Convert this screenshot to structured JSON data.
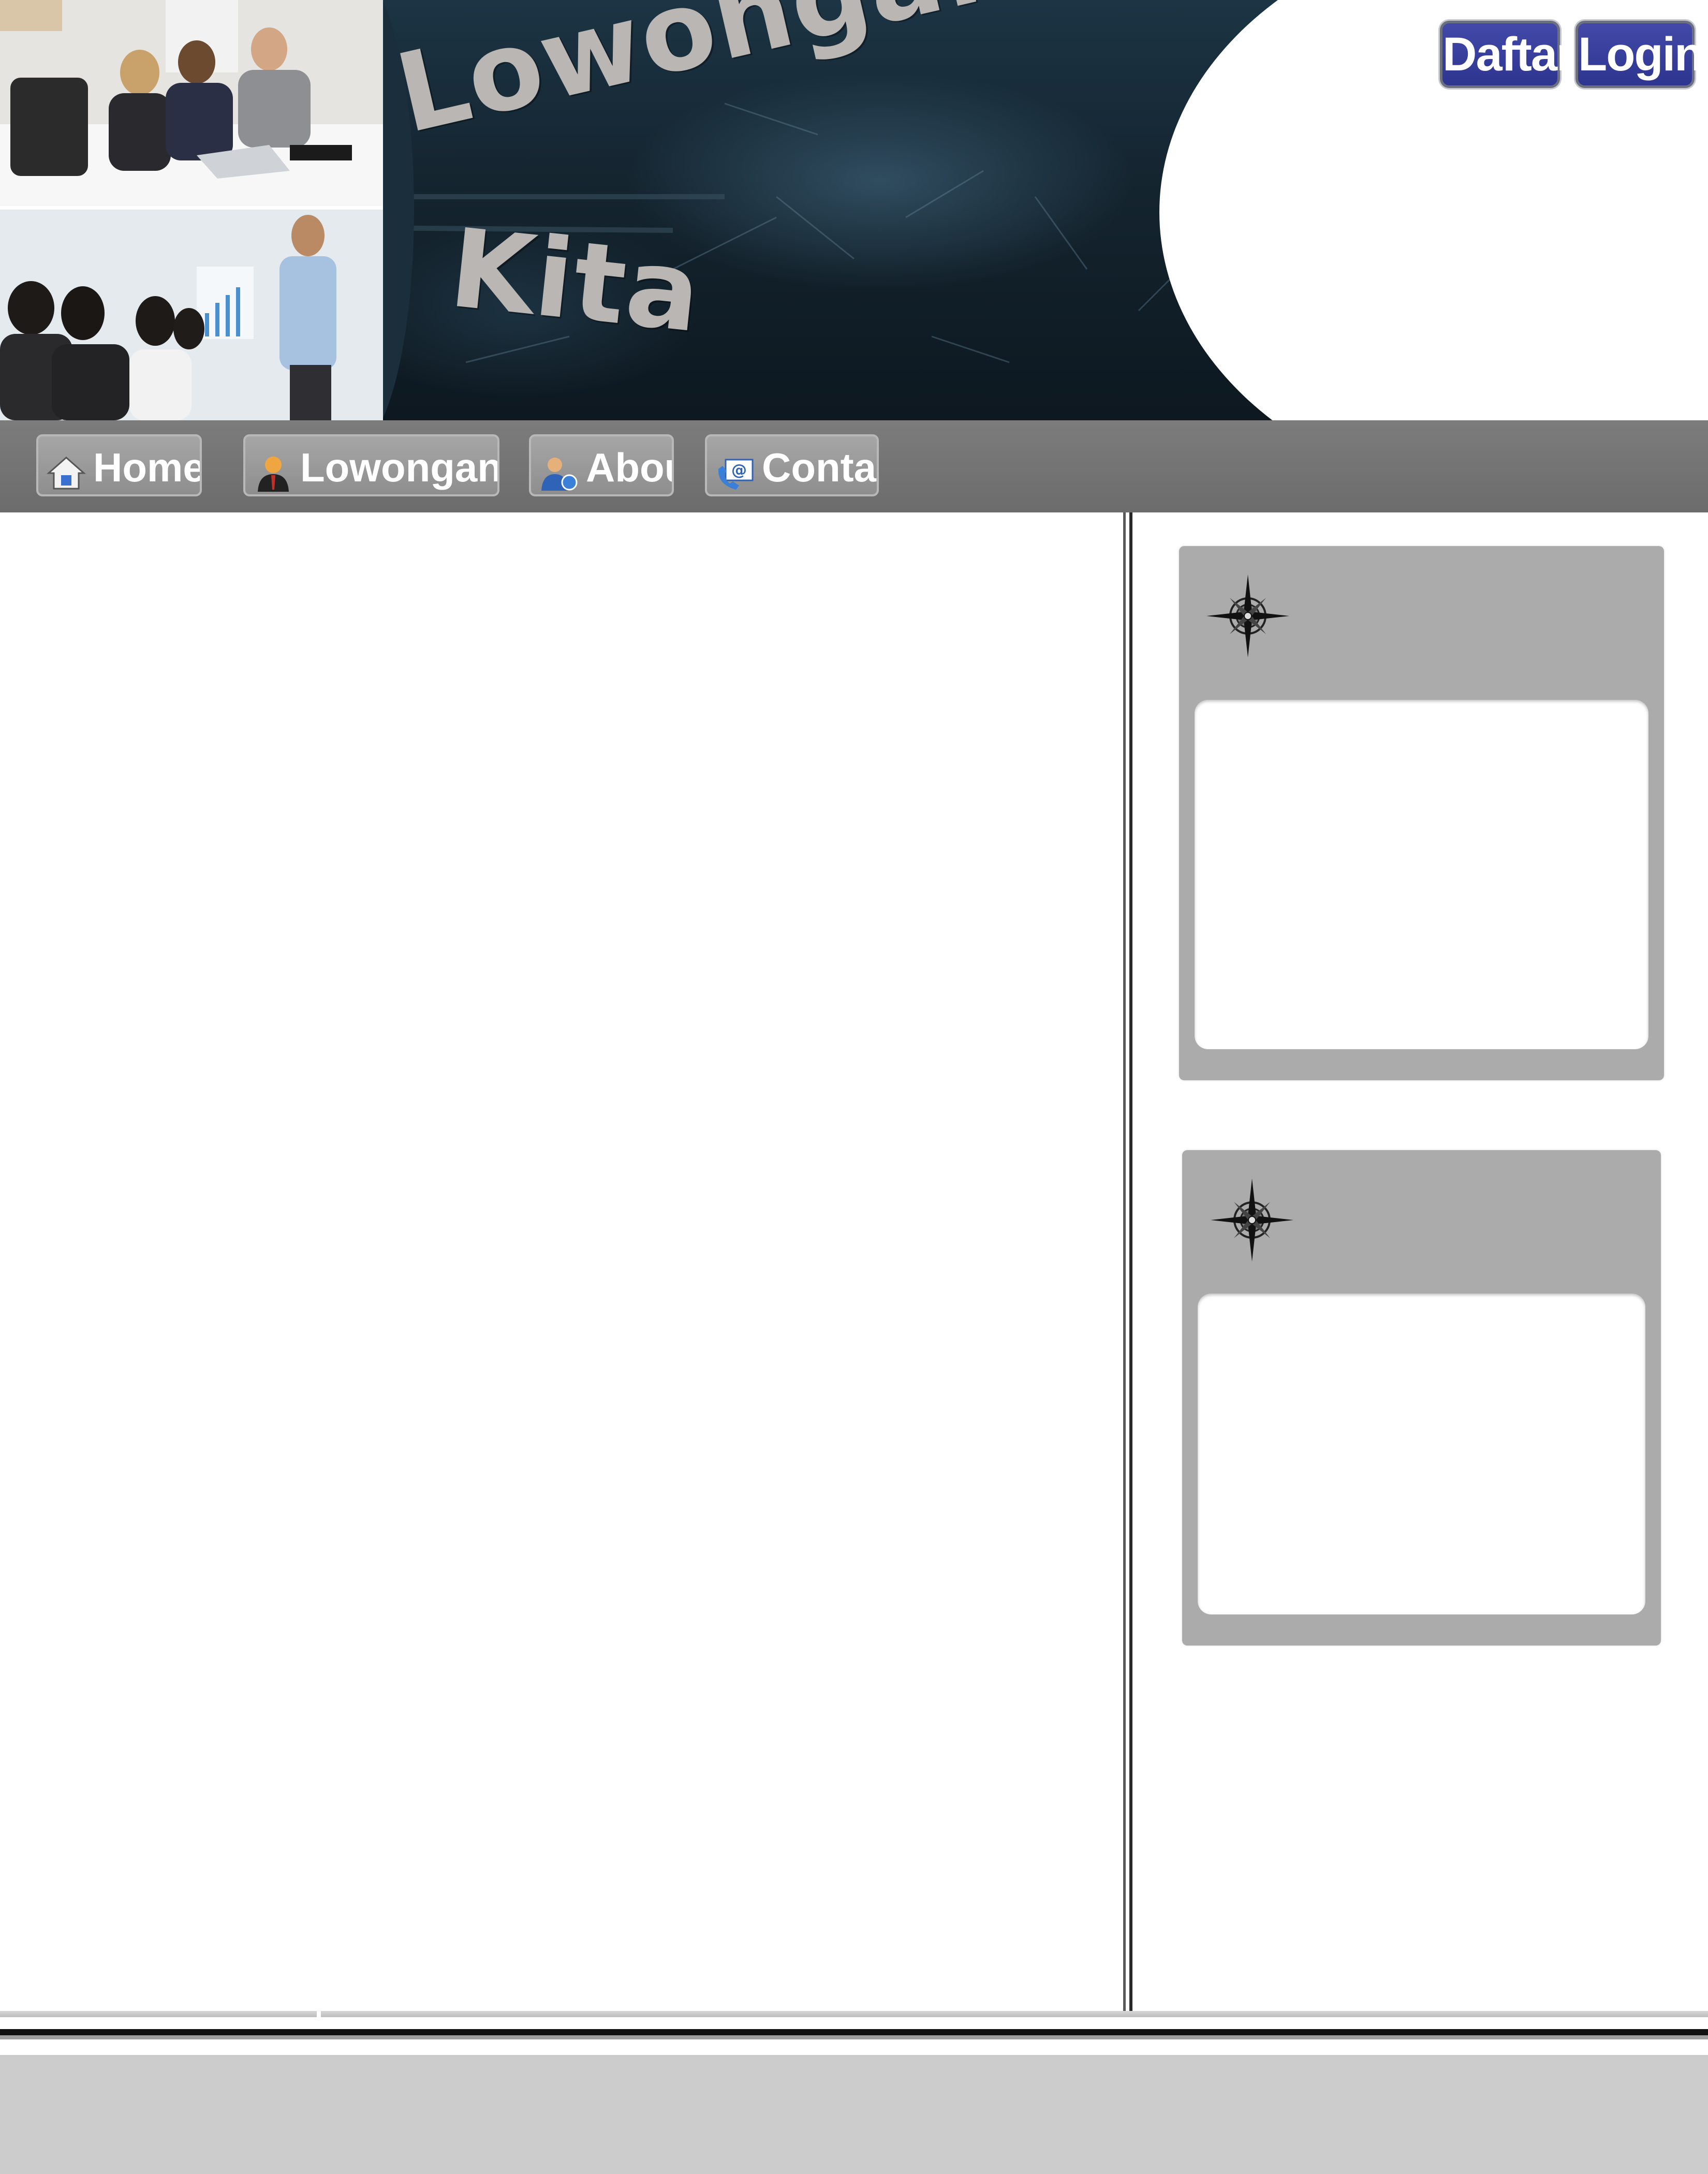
{
  "header": {
    "logo_line1": "Lowongan",
    "logo_line2": "Kita",
    "auth_buttons": {
      "daftar_label": "Daftar",
      "login_label": "Login"
    },
    "hero_images": [
      "team-meeting-photo",
      "presentation-photo"
    ]
  },
  "nav": {
    "items": [
      {
        "label": "Home",
        "icon": "home-icon"
      },
      {
        "label": "Lowongan",
        "icon": "person-icon"
      },
      {
        "label": "About",
        "icon": "users-icon"
      },
      {
        "label": "Contact",
        "icon": "contact-icon"
      }
    ]
  },
  "sidebar": {
    "widgets": [
      {
        "icon": "compass-icon"
      },
      {
        "icon": "compass-icon"
      }
    ]
  },
  "colors": {
    "auth_button": "#3a41a0",
    "nav_bar": "#747474",
    "nav_button": "#9a9a9a",
    "widget": "#ababab",
    "footer": "#cccccc",
    "logo_text": "#b9b6b3"
  }
}
